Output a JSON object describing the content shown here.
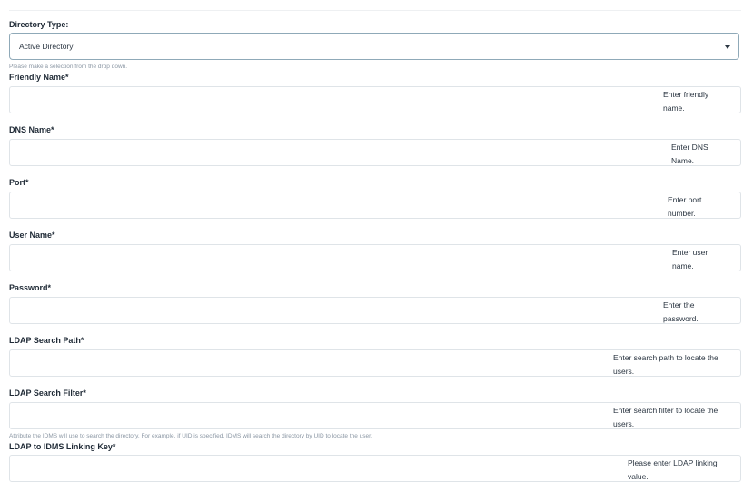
{
  "form": {
    "directory_type": {
      "label": "Directory Type:",
      "selected": "Active Directory",
      "helper": "Please make a selection from the drop down."
    },
    "friendly_name": {
      "label": "Friendly Name*",
      "placeholder": "Enter friendly name."
    },
    "dns_name": {
      "label": "DNS Name*",
      "placeholder": "Enter DNS Name."
    },
    "port": {
      "label": "Port*",
      "placeholder": "Enter port number."
    },
    "user_name": {
      "label": "User Name*",
      "placeholder": "Enter user name."
    },
    "password": {
      "label": "Password*",
      "placeholder": "Enter the password."
    },
    "ldap_search_path": {
      "label": "LDAP Search Path*",
      "placeholder": "Enter search path to locate the users."
    },
    "ldap_search_filter": {
      "label": "LDAP Search Filter*",
      "placeholder": "Enter search filter to locate the users.",
      "helper": "Attribute the IDMS will use to search the directory. For example, if UID is specified, IDMS will search the directory by UID to locate the user."
    },
    "ldap_linking_key": {
      "label": "LDAP to IDMS Linking Key*",
      "placeholder": "Please enter LDAP linking value."
    }
  },
  "icons": {
    "dropdown": "chevron-down-icon"
  }
}
